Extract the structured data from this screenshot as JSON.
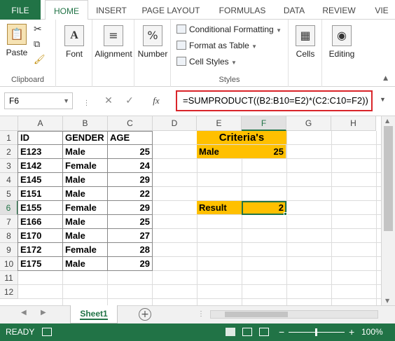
{
  "ribbon_tabs": [
    "FILE",
    "HOME",
    "INSERT",
    "PAGE LAYOUT",
    "FORMULAS",
    "DATA",
    "REVIEW",
    "VIE"
  ],
  "groups": {
    "clipboard": {
      "paste": "Paste",
      "label": "Clipboard"
    },
    "font": "Font",
    "alignment": "Alignment",
    "number": "Number",
    "styles": {
      "conditional": "Conditional Formatting",
      "format_table": "Format as Table",
      "cell_styles": "Cell Styles",
      "label": "Styles"
    },
    "cells": "Cells",
    "editing": "Editing"
  },
  "formula_bar": {
    "name_box": "F6",
    "fx": "fx",
    "formula": "=SUMPRODUCT((B2:B10=E2)*(C2:C10=F2))"
  },
  "columns": [
    "A",
    "B",
    "C",
    "D",
    "E",
    "F",
    "G",
    "H"
  ],
  "rows": [
    "1",
    "2",
    "3",
    "4",
    "5",
    "6",
    "7",
    "8",
    "9",
    "10",
    "11",
    "12"
  ],
  "headers": {
    "id": "ID",
    "gender": "GENDER",
    "age": "AGE"
  },
  "data": [
    {
      "id": "E123",
      "gender": "Male",
      "age": "25"
    },
    {
      "id": "E142",
      "gender": "Female",
      "age": "24"
    },
    {
      "id": "E145",
      "gender": "Male",
      "age": "29"
    },
    {
      "id": "E151",
      "gender": "Male",
      "age": "22"
    },
    {
      "id": "E155",
      "gender": "Female",
      "age": "29"
    },
    {
      "id": "E166",
      "gender": "Male",
      "age": "25"
    },
    {
      "id": "E170",
      "gender": "Male",
      "age": "27"
    },
    {
      "id": "E172",
      "gender": "Female",
      "age": "28"
    },
    {
      "id": "E175",
      "gender": "Male",
      "age": "29"
    }
  ],
  "criteria": {
    "title": "Criteria's",
    "gender": "Male",
    "age": "25"
  },
  "result": {
    "label": "Result",
    "value": "2"
  },
  "sheet": {
    "name": "Sheet1"
  },
  "status": {
    "mode": "READY",
    "zoom": "100%"
  },
  "colors": {
    "excel_green": "#217346",
    "highlight": "#ffc000",
    "formula_border": "#d9252a"
  }
}
